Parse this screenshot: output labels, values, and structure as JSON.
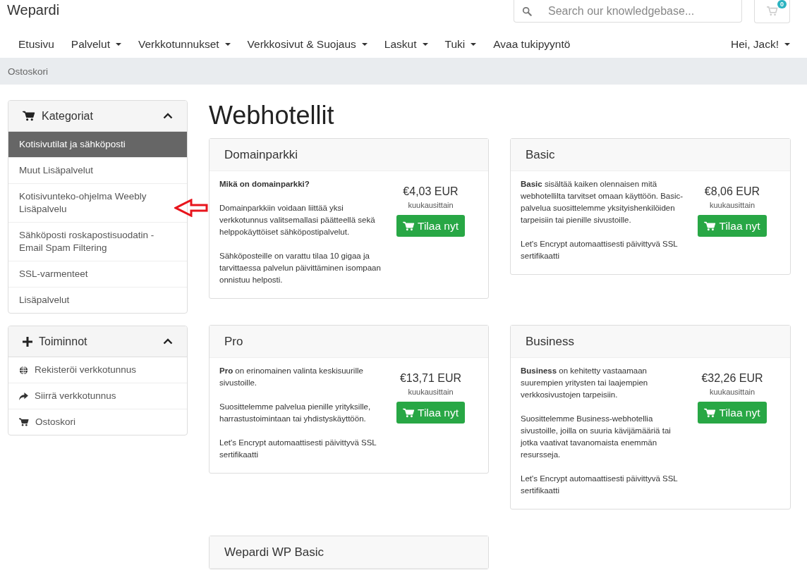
{
  "header": {
    "logo": "Wepardi",
    "search": {
      "placeholder": "Search our knowledgebase..."
    },
    "cart_count": "0"
  },
  "nav": {
    "items": [
      {
        "label": "Etusivu",
        "dropdown": false
      },
      {
        "label": "Palvelut",
        "dropdown": true
      },
      {
        "label": "Verkkotunnukset",
        "dropdown": true
      },
      {
        "label": "Verkkosivut & Suojaus",
        "dropdown": true
      },
      {
        "label": "Laskut",
        "dropdown": true
      },
      {
        "label": "Tuki",
        "dropdown": true
      },
      {
        "label": "Avaa tukipyyntö",
        "dropdown": false
      }
    ],
    "user": {
      "label": "Hei, Jack!",
      "dropdown": true
    }
  },
  "breadcrumb": "Ostoskori",
  "sidebar": {
    "panels": [
      {
        "title": "Kategoriat",
        "kind": "cart",
        "expanded": true,
        "items": [
          {
            "label": "Kotisivutilat ja sähköposti",
            "selected": true
          },
          {
            "label": "Muut Lisäpalvelut",
            "selected": false
          },
          {
            "label": "Kotisivunteko-ohjelma Weebly Lisäpalvelu",
            "selected": false
          },
          {
            "label": "Sähköposti roskapostisuodatin - Email Spam Filtering",
            "selected": false
          },
          {
            "label": "SSL-varmenteet",
            "selected": false
          },
          {
            "label": "Lisäpalvelut",
            "selected": false
          }
        ]
      },
      {
        "title": "Toiminnot",
        "kind": "plus",
        "expanded": true,
        "items": [
          {
            "label": "Rekisteröi verkkotunnus",
            "kind": "globe"
          },
          {
            "label": "Siirrä verkkotunnus",
            "kind": "share"
          },
          {
            "label": "Ostoskori",
            "kind": "cart"
          }
        ]
      }
    ]
  },
  "page_title": "Webhotellit",
  "products": [
    {
      "name": "Domainparkki",
      "paragraphs": [
        "**Mikä on domainparkki?**",
        "Domainparkkiin voidaan liittää yksi verkkotunnus valitsemallasi päätteellä sekä helppokäyttöiset sähköpostipalvelut.",
        "Sähköposteille on varattu tilaa 10 gigaa ja tarvittaessa palvelun päivittäminen isompaan onnistuu helposti."
      ],
      "price": "€4,03 EUR",
      "period": "kuukausittain",
      "button": "Tilaa nyt"
    },
    {
      "name": "Basic",
      "paragraphs": [
        "**Basic** sisältää kaiken olennaisen mitä webhotellilta tarvitset omaan käyttöön. Basic-palvelua suosittelemme yksityishenkilöiden tarpeisiin tai pienille sivustoille.",
        "Let's Encrypt automaattisesti päivittyvä SSL sertifikaatti"
      ],
      "price": "€8,06 EUR",
      "period": "kuukausittain",
      "button": "Tilaa nyt"
    },
    {
      "name": "Pro",
      "paragraphs": [
        "**Pro** on erinomainen valinta keskisuurille sivustoille.",
        "Suosittelemme palvelua pienille yrityksille, harrastustoimintaan tai yhdistyskäyttöön.",
        "Let's Encrypt automaattisesti päivittyvä SSL sertifikaatti"
      ],
      "price": "€13,71 EUR",
      "period": "kuukausittain",
      "button": "Tilaa nyt"
    },
    {
      "name": "Business",
      "paragraphs": [
        "**Business** on kehitetty vastaamaan suurempien yritysten tai laajempien verkkosivustojen tarpeisiin.",
        "Suosittelemme Business-webhotellia sivustoille, joilla on suuria kävijämääriä tai jotka vaativat tavanomaista enemmän resursseja.",
        "Let's Encrypt automaattisesti päivittyvä SSL sertifikaatti"
      ],
      "price": "€32,26 EUR",
      "period": "kuukausittain",
      "button": "Tilaa nyt"
    },
    {
      "name": "Wepardi WP Basic"
    }
  ]
}
